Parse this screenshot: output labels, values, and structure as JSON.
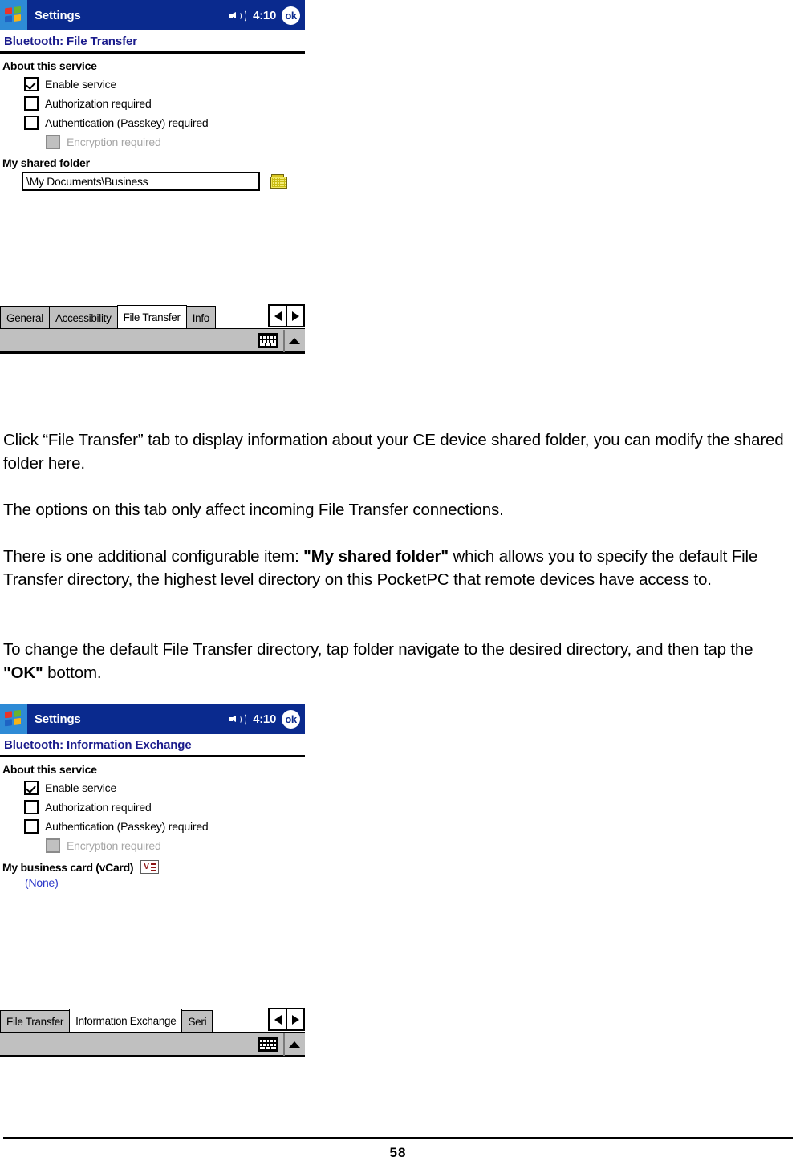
{
  "screenshot1": {
    "titlebar": {
      "app_title": "Settings",
      "time": "4:10",
      "ok_label": "ok",
      "logo_icon": "windows-flag-icon",
      "speaker_icon": "speaker-volume-icon"
    },
    "page_heading": "Bluetooth: File Transfer",
    "section_label": "About this service",
    "checkboxes": [
      {
        "label": "Enable service",
        "checked": true,
        "disabled": false
      },
      {
        "label": "Authorization required",
        "checked": false,
        "disabled": false
      },
      {
        "label": "Authentication (Passkey) required",
        "checked": false,
        "disabled": false
      },
      {
        "label": "Encryption required",
        "checked": false,
        "disabled": true
      }
    ],
    "shared_folder": {
      "label": "My shared folder",
      "value": "\\My Documents\\Business",
      "browse_icon": "folder-icon"
    },
    "tabs": [
      {
        "label": "General",
        "active": false
      },
      {
        "label": "Accessibility",
        "active": false
      },
      {
        "label": "File Transfer",
        "active": true
      },
      {
        "label": "Info",
        "active": false
      }
    ],
    "tab_scroll": {
      "left_icon": "triangle-left-icon",
      "right_icon": "triangle-right-icon"
    },
    "sip": {
      "keyboard_icon": "keyboard-icon",
      "arrow_icon": "triangle-up-icon"
    }
  },
  "prose": {
    "p1_part1": "Click “File Transfer” tab to display information about your CE device shared folder, you can modify the shared folder here.",
    "p2": "The options on this tab only affect incoming File Transfer connections.",
    "p3_a": "There is one additional configurable item: ",
    "p3_b": "\"My shared folder\"",
    "p3_c": " which allows you to specify the default File Transfer directory, the highest level directory on this PocketPC that remote devices have access to.",
    "p4_a": "To change the default File Transfer directory, tap folder navigate to the desired directory, and then tap the ",
    "p4_b": "\"OK\"",
    "p4_c": " bottom."
  },
  "screenshot2": {
    "titlebar": {
      "app_title": "Settings",
      "time": "4:10",
      "ok_label": "ok",
      "logo_icon": "windows-flag-icon",
      "speaker_icon": "speaker-volume-icon"
    },
    "page_heading": "Bluetooth: Information Exchange",
    "section_label": "About this service",
    "checkboxes": [
      {
        "label": "Enable service",
        "checked": true,
        "disabled": false
      },
      {
        "label": "Authorization required",
        "checked": false,
        "disabled": false
      },
      {
        "label": "Authentication (Passkey) required",
        "checked": false,
        "disabled": false
      },
      {
        "label": "Encryption required",
        "checked": false,
        "disabled": true
      }
    ],
    "business_card": {
      "label": "My business card (vCard)",
      "icon": "vcard-icon",
      "value": "(None)"
    },
    "tabs": [
      {
        "label": "File Transfer",
        "active": false
      },
      {
        "label": "Information Exchange",
        "active": true
      },
      {
        "label": "Seri",
        "active": false
      }
    ],
    "tab_scroll": {
      "left_icon": "triangle-left-icon",
      "right_icon": "triangle-right-icon"
    },
    "sip": {
      "keyboard_icon": "keyboard-icon",
      "arrow_icon": "triangle-up-icon"
    }
  },
  "footer": {
    "page_number": "58"
  }
}
